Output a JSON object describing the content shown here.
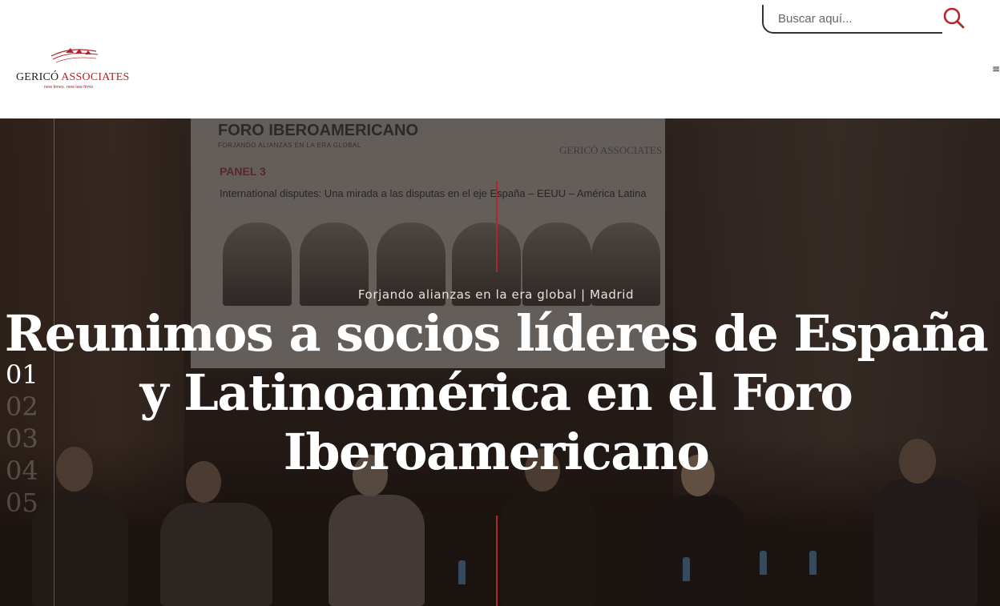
{
  "brand": {
    "name_part1": "GERICÓ",
    "name_part2": "ASSOCIATES",
    "tagline": "new times. new law firms",
    "accent_color": "#b3252a"
  },
  "search": {
    "placeholder": "Buscar aquí...",
    "icon": "search-icon"
  },
  "menu": {
    "icon": "hamburger-menu-icon",
    "glyph": "≡"
  },
  "hero": {
    "kicker": "Forjando alianzas en la era global | Madrid",
    "headline": "Reunimos a socios líderes de España y Latinoamérica en el Foro Iberoamericano",
    "slides": [
      "01",
      "02",
      "03",
      "04",
      "05"
    ],
    "active_slide": "01",
    "background_screen": {
      "title": "FORO IBEROAMERICANO",
      "subtitle": "FORJANDO ALIANZAS EN LA ERA GLOBAL",
      "panel": "PANEL 3",
      "topic": "International disputes: Una mirada a las disputas en el eje España – EEUU – América Latina",
      "logo": "GERICÓ ASSOCIATES"
    }
  }
}
